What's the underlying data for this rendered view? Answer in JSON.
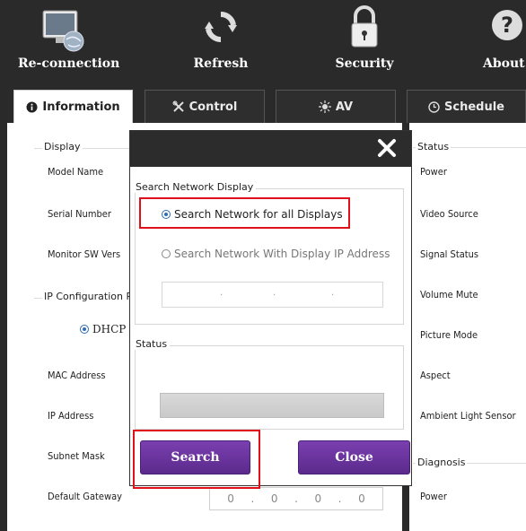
{
  "toolbar": {
    "reconnection": "Re-connection",
    "refresh": "Refresh",
    "security": "Security",
    "about": "About"
  },
  "tabs": [
    {
      "label": "Information",
      "icon": "info-icon"
    },
    {
      "label": "Control",
      "icon": "tools-icon"
    },
    {
      "label": "AV",
      "icon": "sun-icon"
    },
    {
      "label": "Schedule",
      "icon": "clock-icon"
    }
  ],
  "info": {
    "display_group": "Display",
    "model_name": "Model Name",
    "serial_number": "Serial Number",
    "monitor_sw": "Monitor SW Vers",
    "ip_config": "IP Configuration R",
    "dhcp": "DHCP",
    "mac_address": "MAC Address",
    "ip_address": "IP Address",
    "subnet_mask": "Subnet Mask",
    "default_gateway": "Default Gateway",
    "gateway_value": [
      "0",
      ".",
      "0",
      ".",
      "0",
      ".",
      "0"
    ]
  },
  "status_panel": {
    "status_group": "Status",
    "power": "Power",
    "video_source": "Video Source",
    "signal_status": "Signal Status",
    "volume_mute": "Volume Mute",
    "picture_mode": "Picture Mode",
    "aspect": "Aspect",
    "ambient_light": "Ambient Light Sensor",
    "diagnosis_group": "Diagnosis",
    "diag_power": "Power"
  },
  "dialog": {
    "search_group": "Search Network Display",
    "option_all": "Search Network for all Displays",
    "option_ip": "Search Network With Display IP Address",
    "status_group": "Status",
    "search_button": "Search",
    "close_button": "Close"
  },
  "colors": {
    "toolbar_bg": "#2a2a2a",
    "button_purple": "#6a35a0",
    "highlight_red": "#e0101b"
  }
}
